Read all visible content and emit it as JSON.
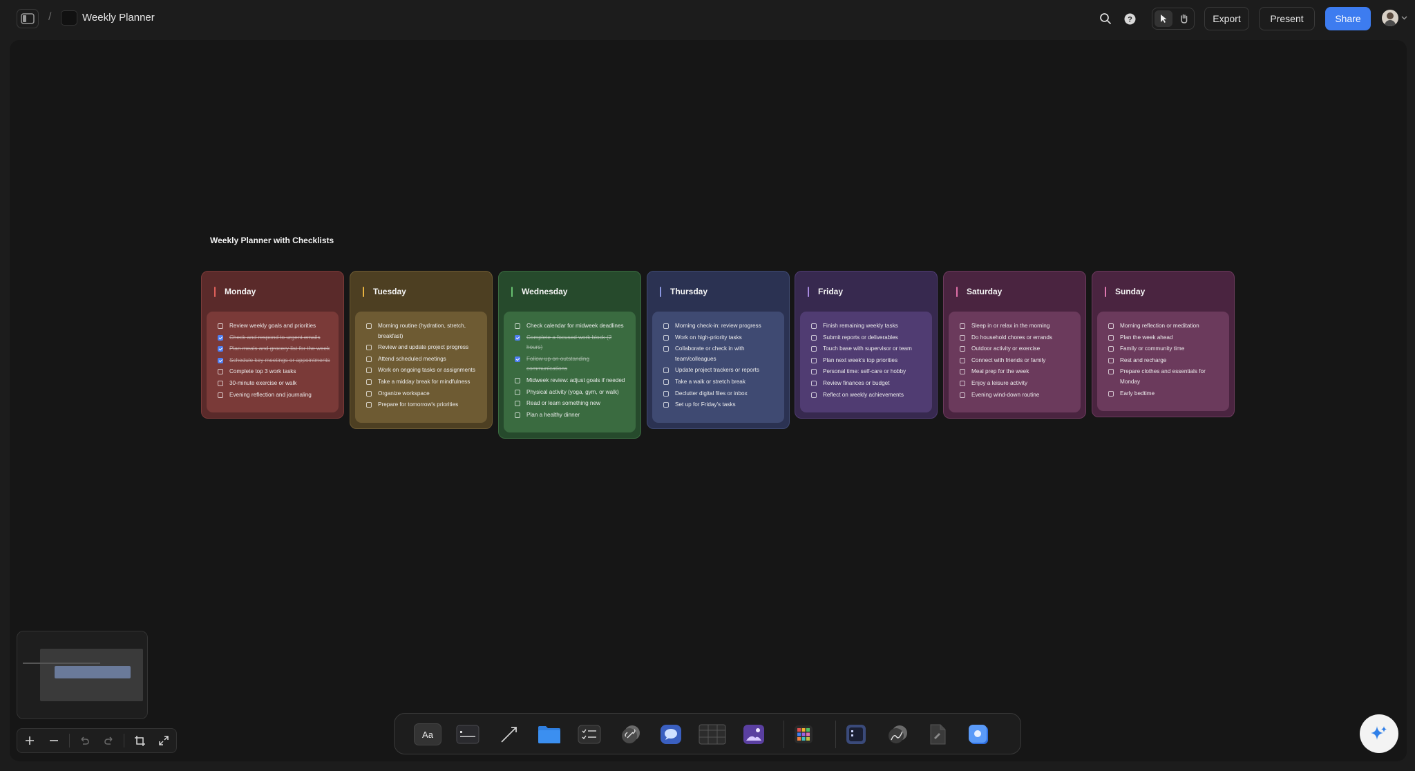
{
  "header": {
    "breadcrumb_separator": "/",
    "doc_title": "Weekly Planner",
    "export_label": "Export",
    "present_label": "Present",
    "share_label": "Share",
    "accent_color": "#3d7cf0"
  },
  "board": {
    "title": "Weekly Planner with Checklists",
    "days": [
      {
        "name": "Monday",
        "bar_color": "#e0605a",
        "card_color": "#5a2a2a",
        "body_color": "#7a3a38",
        "tasks": [
          {
            "text": "Review weekly goals and priorities",
            "done": false
          },
          {
            "text": "Check and respond to urgent emails",
            "done": true
          },
          {
            "text": "Plan meals and grocery list for the week",
            "done": true
          },
          {
            "text": "Schedule key meetings or appointments",
            "done": true
          },
          {
            "text": "Complete top 3 work tasks",
            "done": false
          },
          {
            "text": "30-minute exercise or walk",
            "done": false
          },
          {
            "text": "Evening reflection and journaling",
            "done": false
          }
        ]
      },
      {
        "name": "Tuesday",
        "bar_color": "#e8b340",
        "card_color": "#4d3f22",
        "body_color": "#6e5b33",
        "tasks": [
          {
            "text": "Morning routine (hydration, stretch, breakfast)",
            "done": false
          },
          {
            "text": "Review and update project progress",
            "done": false
          },
          {
            "text": "Attend scheduled meetings",
            "done": false
          },
          {
            "text": "Work on ongoing tasks or assignments",
            "done": false
          },
          {
            "text": "Take a midday break for mindfulness",
            "done": false
          },
          {
            "text": "Organize workspace",
            "done": false
          },
          {
            "text": "Prepare for tomorrow's priorities",
            "done": false
          }
        ]
      },
      {
        "name": "Wednesday",
        "bar_color": "#68c070",
        "card_color": "#264a2c",
        "body_color": "#3a6b40",
        "tasks": [
          {
            "text": "Check calendar for midweek deadlines",
            "done": false
          },
          {
            "text": "Complete a focused work block (2 hours)",
            "done": true
          },
          {
            "text": "Follow up on outstanding communications",
            "done": true
          },
          {
            "text": "Midweek review: adjust goals if needed",
            "done": false
          },
          {
            "text": "Physical activity (yoga, gym, or walk)",
            "done": false
          },
          {
            "text": "Read or learn something new",
            "done": false
          },
          {
            "text": "Plan a healthy dinner",
            "done": false
          }
        ]
      },
      {
        "name": "Thursday",
        "bar_color": "#8a96e0",
        "card_color": "#2b3252",
        "body_color": "#3f4a72",
        "tasks": [
          {
            "text": "Morning check-in: review progress",
            "done": false
          },
          {
            "text": "Work on high-priority tasks",
            "done": false
          },
          {
            "text": "Collaborate or check in with team/colleagues",
            "done": false
          },
          {
            "text": "Update project trackers or reports",
            "done": false
          },
          {
            "text": "Take a walk or stretch break",
            "done": false
          },
          {
            "text": "Declutter digital files or inbox",
            "done": false
          },
          {
            "text": "Set up for Friday's tasks",
            "done": false
          }
        ]
      },
      {
        "name": "Friday",
        "bar_color": "#a88ae0",
        "card_color": "#37294f",
        "body_color": "#503c72",
        "tasks": [
          {
            "text": "Finish remaining weekly tasks",
            "done": false
          },
          {
            "text": "Submit reports or deliverables",
            "done": false
          },
          {
            "text": "Touch base with supervisor or team",
            "done": false
          },
          {
            "text": "Plan next week's top priorities",
            "done": false
          },
          {
            "text": "Personal time: self-care or hobby",
            "done": false
          },
          {
            "text": "Review finances or budget",
            "done": false
          },
          {
            "text": "Reflect on weekly achievements",
            "done": false
          }
        ]
      },
      {
        "name": "Saturday",
        "bar_color": "#e070a8",
        "card_color": "#4a2440",
        "body_color": "#6b3a5c",
        "tasks": [
          {
            "text": "Sleep in or relax in the morning",
            "done": false
          },
          {
            "text": "Do household chores or errands",
            "done": false
          },
          {
            "text": "Outdoor activity or exercise",
            "done": false
          },
          {
            "text": "Connect with friends or family",
            "done": false
          },
          {
            "text": "Meal prep for the week",
            "done": false
          },
          {
            "text": "Enjoy a leisure activity",
            "done": false
          },
          {
            "text": "Evening wind-down routine",
            "done": false
          }
        ]
      },
      {
        "name": "Sunday",
        "bar_color": "#e078b0",
        "card_color": "#4a2440",
        "body_color": "#6b3a5c",
        "tasks": [
          {
            "text": "Morning reflection or meditation",
            "done": false
          },
          {
            "text": "Plan the week ahead",
            "done": false
          },
          {
            "text": "Family or community time",
            "done": false
          },
          {
            "text": "Rest and recharge",
            "done": false
          },
          {
            "text": "Prepare clothes and essentials for Monday",
            "done": false
          },
          {
            "text": "Early bedtime",
            "done": false
          }
        ]
      }
    ]
  },
  "toolbar": {
    "text_tool_label": "Aa",
    "tools": [
      "text-tool",
      "sticky-note-tool",
      "connector-arrow-tool",
      "folder-tool",
      "checklist-tool",
      "link-tool",
      "comment-tool",
      "table-tool",
      "image-tool",
      "apps-tool",
      "mini-board-tool",
      "sketch-tool",
      "document-tool",
      "ai-image-tool"
    ]
  }
}
